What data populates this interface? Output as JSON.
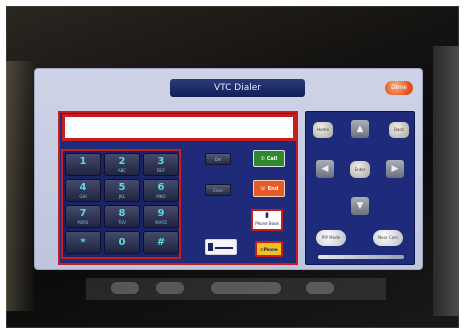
{
  "panel": {
    "title": "VTC Dialer",
    "done_label": "Done"
  },
  "entry": {
    "value": ""
  },
  "keypad": [
    {
      "digit": "1",
      "sub": ""
    },
    {
      "digit": "2",
      "sub": "ABC"
    },
    {
      "digit": "3",
      "sub": "DEF"
    },
    {
      "digit": "4",
      "sub": "GHI"
    },
    {
      "digit": "5",
      "sub": "JKL"
    },
    {
      "digit": "6",
      "sub": "MNO"
    },
    {
      "digit": "7",
      "sub": "PQRS"
    },
    {
      "digit": "8",
      "sub": "TUV"
    },
    {
      "digit": "9",
      "sub": "WXYZ"
    },
    {
      "digit": "*",
      "sub": ""
    },
    {
      "digit": "0",
      "sub": ""
    },
    {
      "digit": "#",
      "sub": ""
    }
  ],
  "mid": {
    "btn1": "Del",
    "btn2": "Clear",
    "call": "Call",
    "hangup": "End",
    "phonebook": "Phone Book",
    "phone": "Phone",
    "bar": ""
  },
  "nav": {
    "home": "Home",
    "back": "Back",
    "enter": "Enter",
    "left_oval": "PIP Mode",
    "right_oval": "Near Cam"
  },
  "colors": {
    "accent_red": "#c41d22",
    "panel_blue": "#1f2a78",
    "call_green": "#2f8a2f",
    "hang_red": "#e65b2a"
  }
}
